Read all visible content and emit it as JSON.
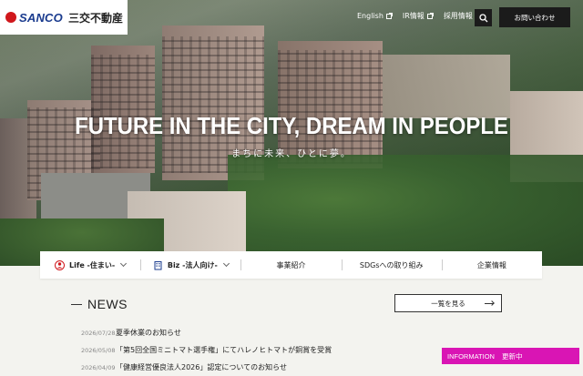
{
  "brand": {
    "logo_en": "SANCO",
    "logo_jp": "三交不動産",
    "accent": "#d0171c",
    "navy": "#1a3b8e"
  },
  "topnav": {
    "links": [
      {
        "label": "English",
        "icon": "external-link-icon"
      },
      {
        "label": "IR情報",
        "icon": "external-link-icon"
      },
      {
        "label": "採用情報",
        "icon": "external-link-icon"
      }
    ],
    "search_icon": "search-icon",
    "contact_label": "お問い合わせ"
  },
  "hero": {
    "title": "FUTURE IN THE CITY, DREAM IN PEOPLE",
    "subtitle": "まちに未来、ひとに夢。"
  },
  "mainnav": {
    "items": [
      {
        "label": "Life -住まい-",
        "icon": "person-icon",
        "bold": true
      },
      {
        "label": "Biz -法人向け-",
        "icon": "building-icon",
        "bold": true
      },
      {
        "label": "事業紹介"
      },
      {
        "label": "SDGsへの取り組み"
      },
      {
        "label": "企業情報"
      }
    ]
  },
  "news": {
    "heading": "NEWS",
    "more_label": "一覧を見る",
    "items": [
      {
        "date": "2026/07/28",
        "text": "夏季休業のお知らせ"
      },
      {
        "date": "2026/05/08",
        "text": "「第5回全国ミニトマト選手権」にてハレノヒトマトが銅賞を受賞"
      },
      {
        "date": "2026/04/09",
        "text": "「健康経営優良法人2026」認定についてのお知らせ"
      }
    ]
  },
  "info_badge": {
    "label": "INFORMATION",
    "status": "更新中",
    "color": "#d915b4"
  }
}
